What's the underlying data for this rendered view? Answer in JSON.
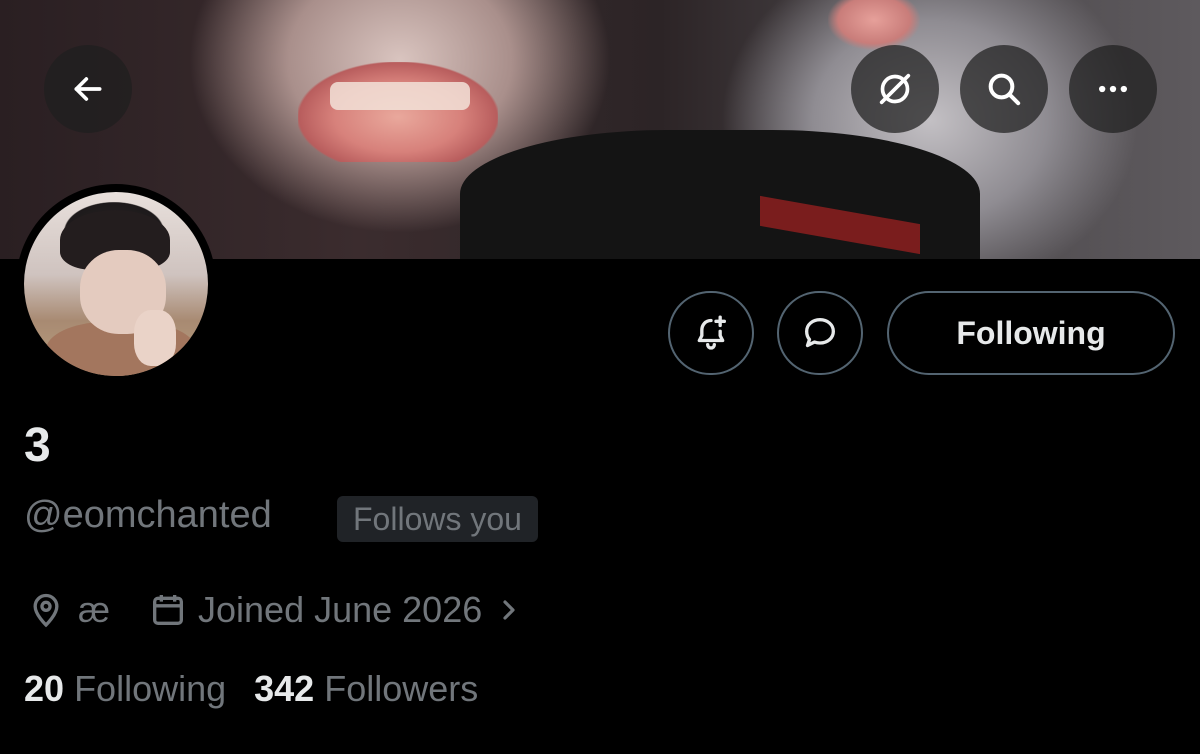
{
  "header": {
    "back_icon": "arrow-left-icon",
    "grok_icon": "grok-icon",
    "search_icon": "search-icon",
    "more_icon": "more-horizontal-icon"
  },
  "profile": {
    "display_name": "3",
    "handle": "@eomchanted",
    "follows_you": "Follows you",
    "location_icon": "location-pin-icon",
    "location": "æ",
    "calendar_icon": "calendar-icon",
    "joined": "Joined June 2026",
    "chevron_icon": "chevron-right-icon"
  },
  "actions": {
    "notify_icon": "bell-plus-icon",
    "message_icon": "chat-bubble-icon",
    "following_label": "Following"
  },
  "stats": {
    "following_count": "20",
    "following_label": "Following",
    "followers_count": "342",
    "followers_label": "Followers"
  },
  "colors": {
    "background": "#000000",
    "primary_text": "#e7e9ea",
    "secondary_text": "#71767b",
    "border": "#536471"
  }
}
